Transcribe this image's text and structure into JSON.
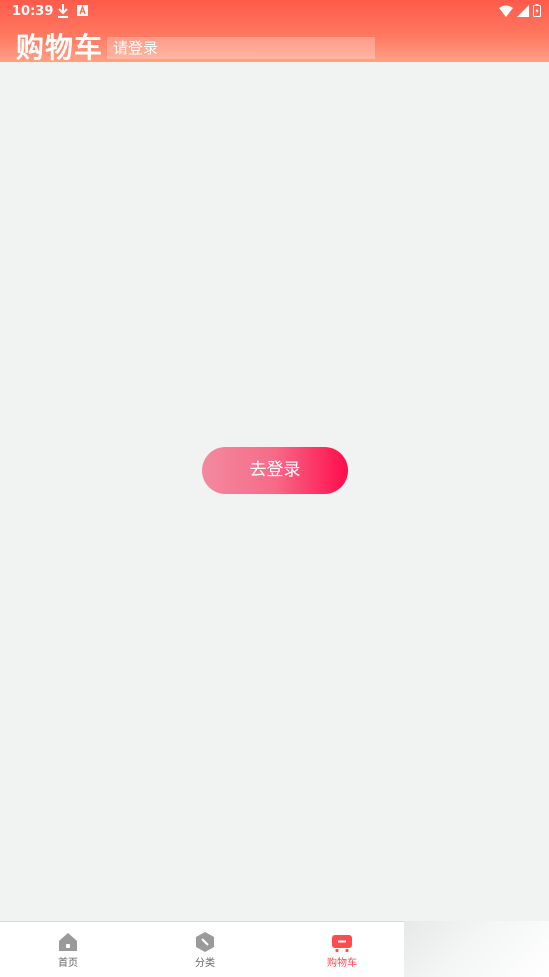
{
  "status_bar": {
    "time": "10:39"
  },
  "header": {
    "title": "购物车",
    "search_placeholder": "请登录"
  },
  "main": {
    "login_button_label": "去登录"
  },
  "tabbar": {
    "items": [
      {
        "label": "首页",
        "icon": "home-icon"
      },
      {
        "label": "分类",
        "icon": "category-icon"
      },
      {
        "label": "购物车",
        "icon": "cart-icon",
        "active": true
      }
    ]
  },
  "colors": {
    "accent": "#ff4b50",
    "header_start": "#ff5a4a",
    "button_end": "#ff0c4c"
  }
}
